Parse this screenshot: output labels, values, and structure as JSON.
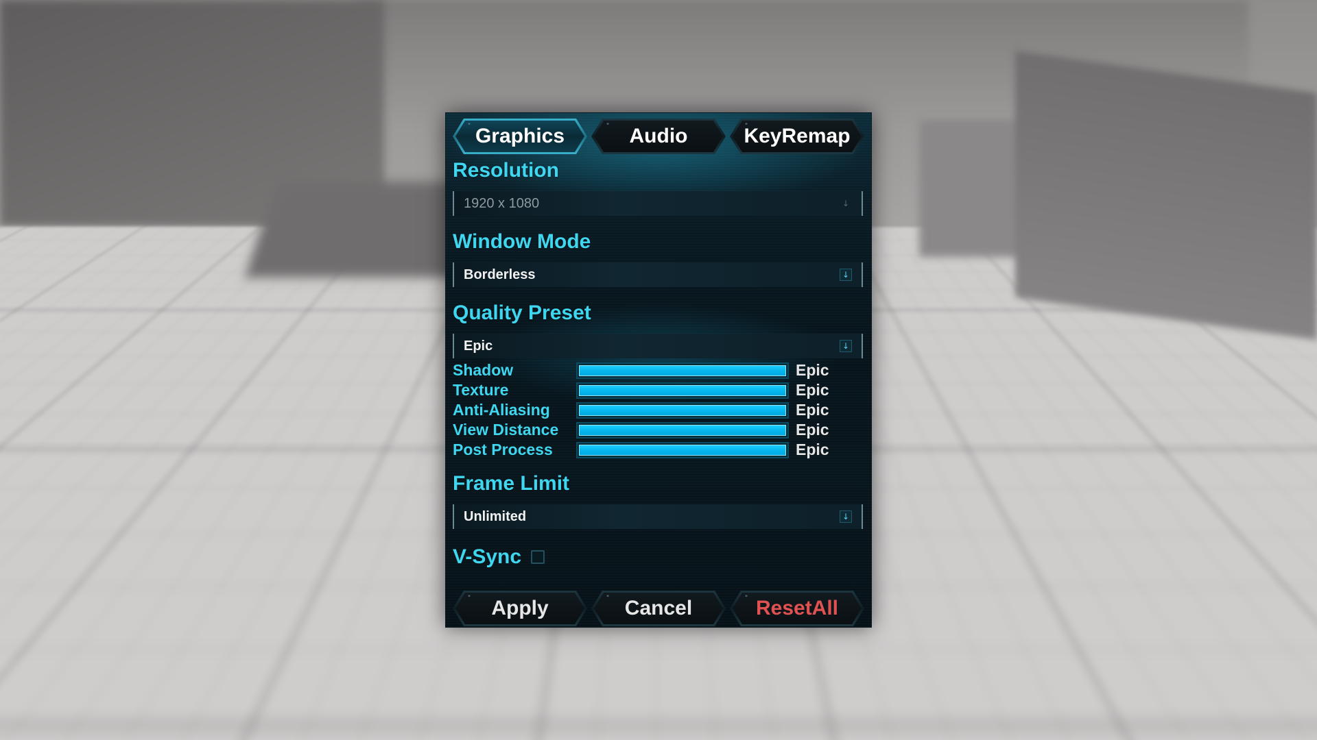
{
  "tabs": [
    {
      "label": "Graphics",
      "active": true
    },
    {
      "label": "Audio",
      "active": false
    },
    {
      "label": "KeyRemap",
      "active": false
    }
  ],
  "resolution": {
    "title": "Resolution",
    "value": "1920 x 1080",
    "enabled": false
  },
  "window_mode": {
    "title": "Window Mode",
    "value": "Borderless"
  },
  "quality_preset": {
    "title": "Quality Preset",
    "value": "Epic",
    "settings": [
      {
        "label": "Shadow",
        "value": "Epic",
        "level": 1.0
      },
      {
        "label": "Texture",
        "value": "Epic",
        "level": 1.0
      },
      {
        "label": "Anti-Aliasing",
        "value": "Epic",
        "level": 1.0
      },
      {
        "label": "View Distance",
        "value": "Epic",
        "level": 1.0
      },
      {
        "label": "Post Process",
        "value": "Epic",
        "level": 1.0
      }
    ]
  },
  "frame_limit": {
    "title": "Frame Limit",
    "value": "Unlimited"
  },
  "vsync": {
    "label": "V-Sync",
    "checked": false
  },
  "footer": {
    "apply_label": "Apply",
    "cancel_label": "Cancel",
    "reset_label": "ResetAll"
  },
  "icons": {
    "dropdown_arrow": "arrow-down-icon"
  },
  "colors": {
    "accent": "#3fd6f0",
    "bar_fill": "#06b7ef",
    "reset": "#e05252",
    "panel_bg": "#07141b"
  }
}
